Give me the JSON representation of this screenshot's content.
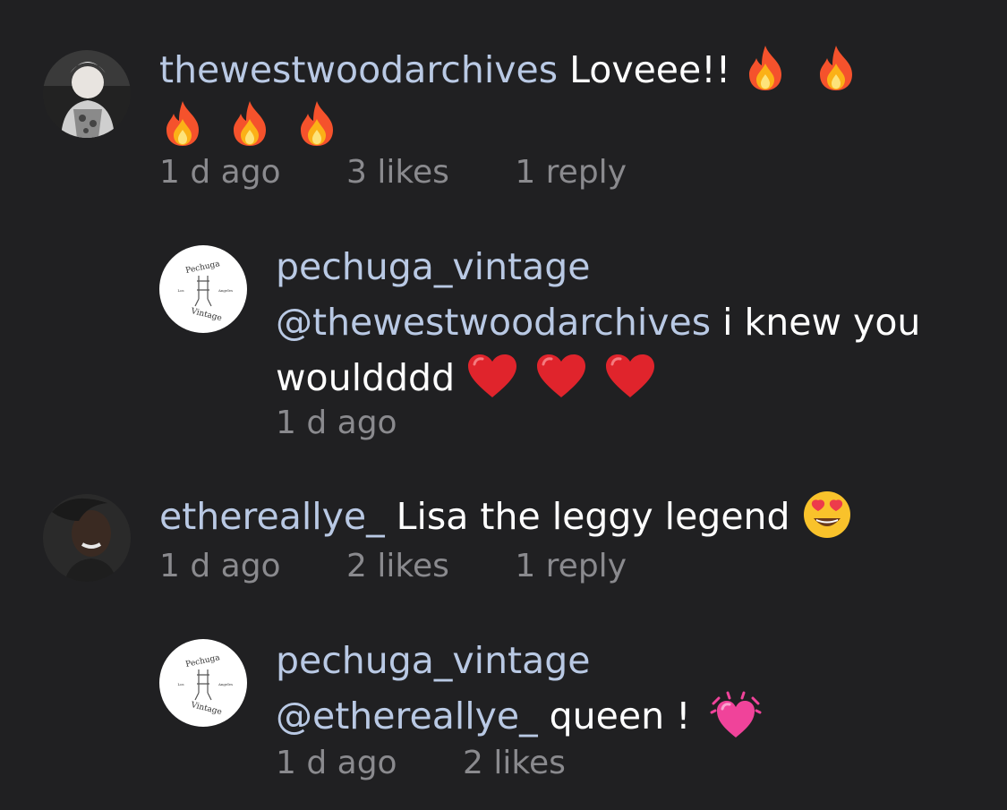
{
  "comments": [
    {
      "username": "thewestwoodarchives",
      "text": "Loveee!!",
      "emoji_icons": [
        "fire-icon",
        "fire-icon",
        "fire-icon",
        "fire-icon",
        "fire-icon"
      ],
      "time": "1 d ago",
      "likes": "3 likes",
      "replies": "1 reply"
    },
    {
      "username": "pechuga_vintage",
      "mention": "@thewestwoodarchives",
      "text_line1": "i knew you",
      "text_line2": "wouldddd",
      "emoji_icons": [
        "red-heart-icon",
        "red-heart-icon",
        "red-heart-icon"
      ],
      "time": "1 d ago",
      "logo_text": {
        "top": "Pechuga",
        "bottom": "Vintage",
        "left": "Los",
        "right": "Angeles"
      }
    },
    {
      "username": "ethereallye_",
      "text": "Lisa the leggy legend",
      "emoji_icons": [
        "heart-eyes-icon"
      ],
      "time": "1 d ago",
      "likes": "2 likes",
      "replies": "1 reply"
    },
    {
      "username": "pechuga_vintage",
      "mention": "@ethereallye_",
      "text": "queen !",
      "emoji_icons": [
        "vibrating-heart-icon"
      ],
      "time": "1 d ago",
      "likes": "2 likes",
      "logo_text": {
        "top": "Pechuga",
        "bottom": "Vintage",
        "left": "Los",
        "right": "Angeles"
      }
    }
  ],
  "colors": {
    "background": "#202022",
    "username": "#b9c9e4",
    "meta": "#8a8a8e",
    "text": "#ffffff"
  }
}
